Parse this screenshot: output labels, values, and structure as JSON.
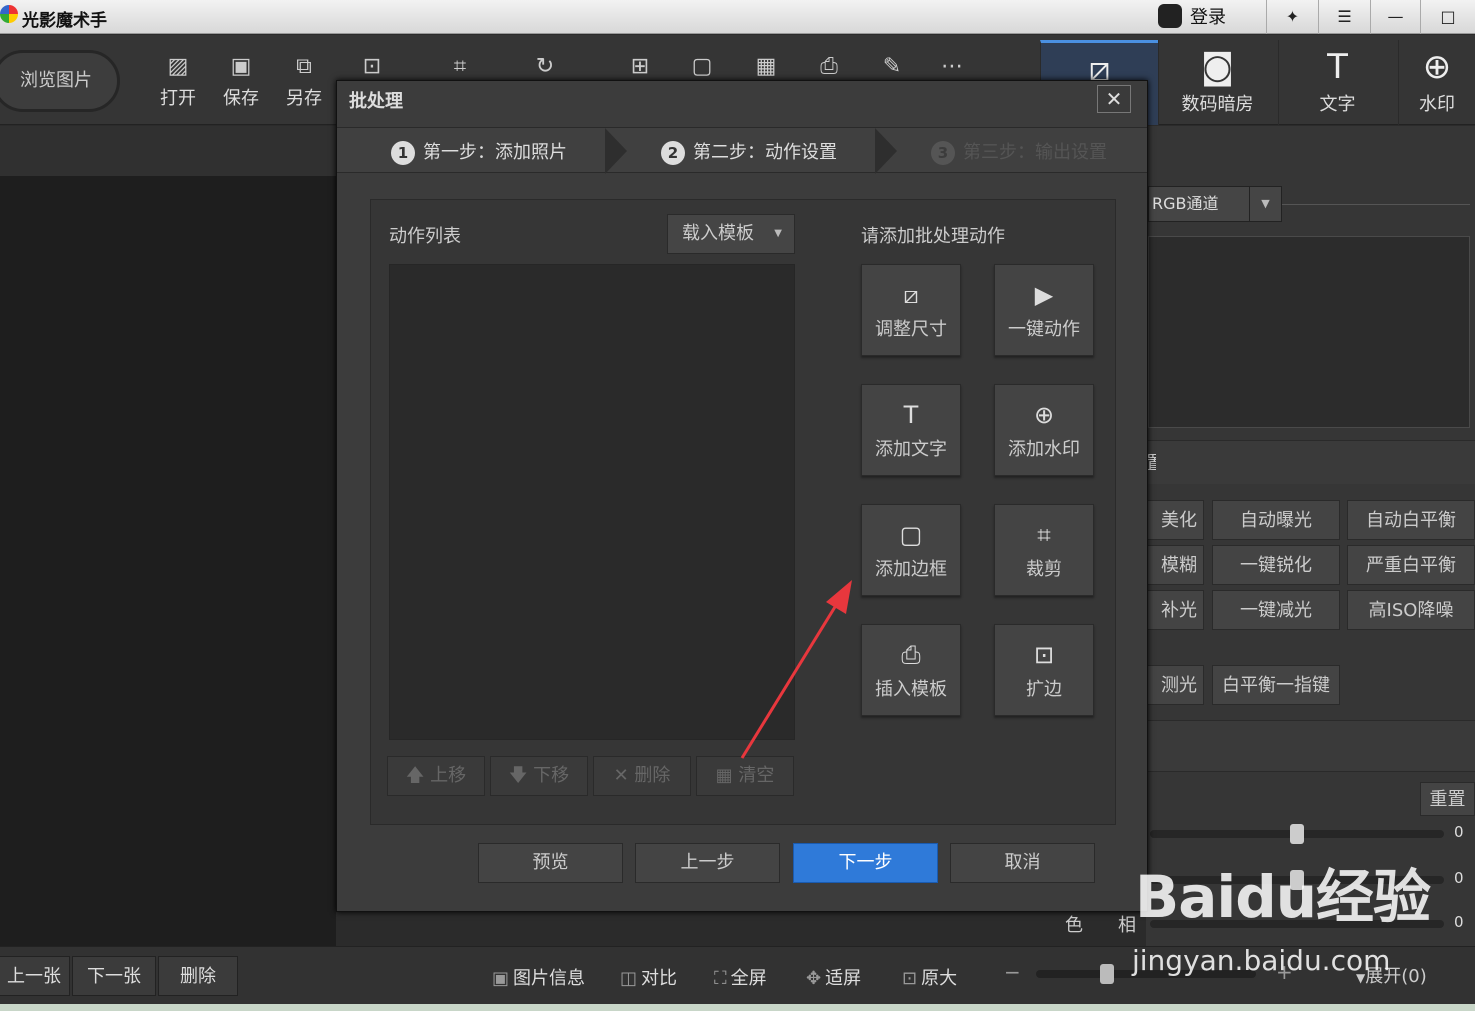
{
  "app": {
    "title": "光影魔术手",
    "login": "登录"
  },
  "toolbar": {
    "browse": "浏览图片",
    "open": "打开",
    "save": "保存",
    "save_as": "另存"
  },
  "right_tabs": [
    "数码暗房",
    "文字",
    "水印"
  ],
  "dialog": {
    "title": "批处理",
    "close": "✕",
    "steps": [
      {
        "num": "1",
        "label": "第一步：添加照片"
      },
      {
        "num": "2",
        "label": "第二步：动作设置"
      },
      {
        "num": "3",
        "label": "第三步：输出设置"
      }
    ],
    "action_list_title": "动作列表",
    "load_template": "载入模板",
    "list_buttons": [
      "上移",
      "下移",
      "删除",
      "清空"
    ],
    "add_title": "请添加批处理动作",
    "actions": [
      "调整尺寸",
      "一键动作",
      "添加文字",
      "添加水印",
      "添加边框",
      "裁剪",
      "插入模板",
      "扩边"
    ],
    "footer": {
      "preview": "预览",
      "prev": "上一步",
      "next": "下一步",
      "cancel": "取消"
    }
  },
  "right_panel": {
    "channel": "RGB通道",
    "section_label": "置",
    "buttons_row1": [
      "美化",
      "自动曝光",
      "自动白平衡"
    ],
    "buttons_row2": [
      "模糊",
      "一键锐化",
      "严重白平衡"
    ],
    "buttons_row3": [
      "补光",
      "一键减光",
      "高ISO降噪"
    ],
    "buttons_row4": [
      "测光",
      "白平衡一指键"
    ],
    "reset": "重置",
    "slider_values": [
      "0",
      "0",
      "0"
    ],
    "color_label": "色",
    "hue_label": "相"
  },
  "bottom": {
    "prev": "上一张",
    "next": "下一张",
    "delete": "删除",
    "info": "图片信息",
    "compare": "对比",
    "fullscreen": "全屏",
    "fit": "适屏",
    "original": "原大",
    "expand": "展开(0)"
  },
  "watermark": {
    "text": "Baidu经验",
    "url": "jingyan.baidu.com"
  }
}
